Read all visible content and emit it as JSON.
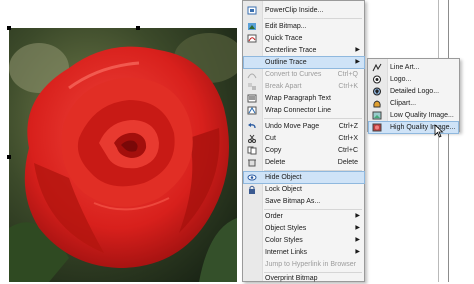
{
  "menu": {
    "items": [
      {
        "label": "PowerClip Inside...",
        "shortcut": ""
      },
      {
        "label": "Edit Bitmap...",
        "shortcut": ""
      },
      {
        "label": "Quick Trace",
        "shortcut": ""
      },
      {
        "label": "Centerline Trace",
        "shortcut": "▶"
      },
      {
        "label": "Outline Trace",
        "shortcut": "▶"
      },
      {
        "label": "Convert to Curves",
        "shortcut": "Ctrl+Q"
      },
      {
        "label": "Break Apart",
        "shortcut": "Ctrl+K"
      },
      {
        "label": "Wrap Paragraph Text",
        "shortcut": ""
      },
      {
        "label": "Wrap Connector Line",
        "shortcut": ""
      },
      {
        "label": "Undo Move Page",
        "shortcut": "Ctrl+Z"
      },
      {
        "label": "Cut",
        "shortcut": "Ctrl+X"
      },
      {
        "label": "Copy",
        "shortcut": "Ctrl+C"
      },
      {
        "label": "Delete",
        "shortcut": "Delete"
      },
      {
        "label": "Hide Object",
        "shortcut": ""
      },
      {
        "label": "Lock Object",
        "shortcut": ""
      },
      {
        "label": "Save Bitmap As...",
        "shortcut": ""
      },
      {
        "label": "Order",
        "shortcut": "▶"
      },
      {
        "label": "Object Styles",
        "shortcut": "▶"
      },
      {
        "label": "Color Styles",
        "shortcut": "▶"
      },
      {
        "label": "Internet Links",
        "shortcut": "▶"
      },
      {
        "label": "Jump to Hyperlink in Browser",
        "shortcut": ""
      },
      {
        "label": "Overprint Bitmap",
        "shortcut": ""
      }
    ]
  },
  "submenu": {
    "items": [
      {
        "label": "Line Art..."
      },
      {
        "label": "Logo..."
      },
      {
        "label": "Detailed Logo..."
      },
      {
        "label": "Clipart..."
      },
      {
        "label": "Low Quality Image..."
      },
      {
        "label": "High Quality Image..."
      }
    ]
  },
  "colors": {
    "highlight": "#cfe3f7",
    "highlight_border": "#8fb8de",
    "menu_bg": "#f4f4f4",
    "disabled_text": "#9c9c9c",
    "rose_red": "#d8201c"
  }
}
